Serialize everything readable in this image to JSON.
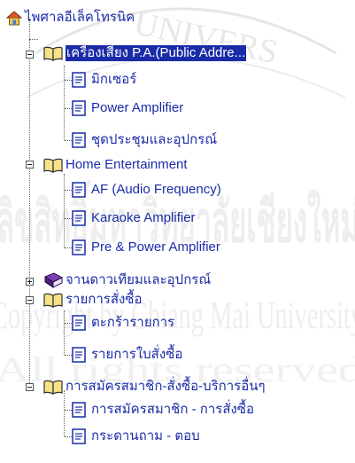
{
  "watermark": {
    "text1": "UNIVERS",
    "text2": "ลิขสิทธิ์มหาวิทยาลัยเชียงใหม่",
    "text3": "Copyright by Chiang Mai University",
    "text4": "All rights reserved"
  },
  "tree": {
    "root": "ไพศาลอีเล็คโทรนิค",
    "groups": [
      {
        "label": "เครื่องเสียง P.A.(Public Addre...",
        "expanded": true,
        "children": [
          "มิกเซอร์",
          "Power Amplifier",
          "ชุดประชุมและอุปกรณ์"
        ]
      },
      {
        "label": "Home Entertainment",
        "expanded": true,
        "children": [
          "AF (Audio Frequency)",
          "Karaoke Amplifier",
          "Pre & Power Amplifier"
        ]
      },
      {
        "label": "จานดาวเทียมและอุปกรณ์",
        "expanded": false,
        "children": []
      },
      {
        "label": "รายการสั่งซื้อ",
        "expanded": true,
        "children": [
          "ตะกร้ารายการ",
          "รายการใบสั่งซื้อ"
        ]
      },
      {
        "label": "การสมัครสมาชิก-สั่งซื้อ-บริการอื่นๆ",
        "expanded": true,
        "children": [
          "การสมัครสมาชิก - การสั่งซื้อ",
          "กระดานถาม - ตอบ"
        ]
      }
    ]
  },
  "colors": {
    "text": "#1a2ba8",
    "highlight": "#1a2ba8",
    "watermark": "#e7e7e7"
  }
}
